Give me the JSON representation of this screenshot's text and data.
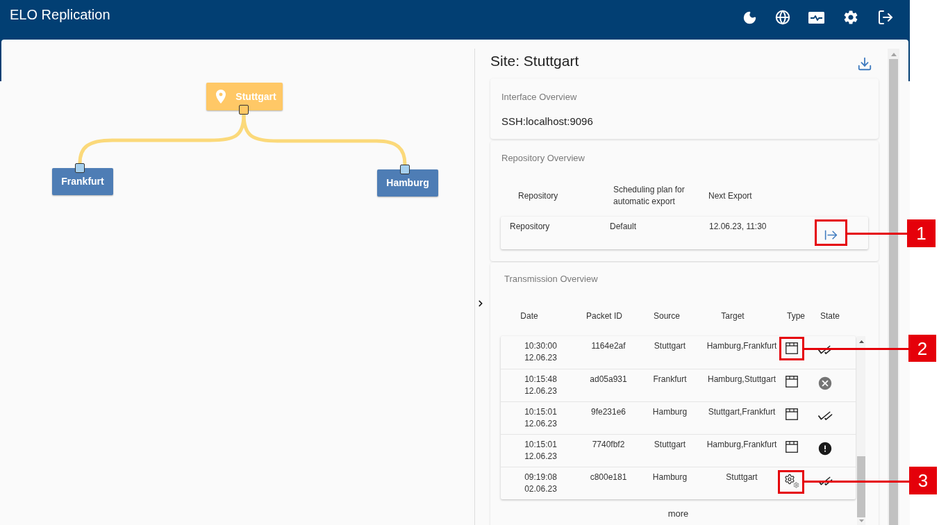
{
  "header": {
    "title": "ELO Replication"
  },
  "diagram": {
    "nodes": [
      {
        "label": "Stuttgart",
        "selected": true,
        "children": [
          {
            "label": "Frankfurt",
            "selected": false
          },
          {
            "label": "Hamburg",
            "selected": false
          }
        ]
      }
    ]
  },
  "site_panel": {
    "title": "Site: Stuttgart",
    "interface_overview": {
      "title": "Interface Overview",
      "value": "SSH:localhost:9096"
    },
    "repository_overview": {
      "title": "Repository Overview",
      "columns": [
        "Repository",
        "Scheduling plan for automatic export",
        "Next Export"
      ],
      "rows": [
        {
          "repository": "Repository",
          "scheduling_plan": "Default",
          "next_export": "12.06.23, 11:30"
        }
      ]
    },
    "transmission_overview": {
      "title": "Transmission Overview",
      "columns": [
        "Date",
        "Packet ID",
        "Source",
        "Target",
        "Type",
        "State"
      ],
      "rows": [
        {
          "time": "10:30:00",
          "date": "12.06.23",
          "packet_id": "1164e2af",
          "source": "Stuttgart",
          "target": "Hamburg,Frankfurt",
          "type": {
            "kind": "window"
          },
          "state": {
            "kind": "done"
          }
        },
        {
          "time": "10:15:48",
          "date": "12.06.23",
          "packet_id": "ad05a931",
          "source": "Frankfurt",
          "target": "Hamburg,Stuttgart",
          "type": {
            "kind": "window"
          },
          "state": {
            "kind": "failed"
          }
        },
        {
          "time": "10:15:01",
          "date": "12.06.23",
          "packet_id": "9fe231e6",
          "source": "Hamburg",
          "target": "Stuttgart,Frankfurt",
          "type": {
            "kind": "window"
          },
          "state": {
            "kind": "done"
          }
        },
        {
          "time": "10:15:01",
          "date": "12.06.23",
          "packet_id": "7740fbf2",
          "source": "Stuttgart",
          "target": "Hamburg,Frankfurt",
          "type": {
            "kind": "window"
          },
          "state": {
            "kind": "warning"
          }
        },
        {
          "time": "09:19:08",
          "date": "02.06.23",
          "packet_id": "c800e181",
          "source": "Hamburg",
          "target": "Stuttgart",
          "type": {
            "kind": "automatic"
          },
          "state": {
            "kind": "done"
          }
        }
      ],
      "more": "more"
    }
  },
  "callouts": [
    {
      "label": "1"
    },
    {
      "label": "2"
    },
    {
      "label": "3"
    }
  ]
}
